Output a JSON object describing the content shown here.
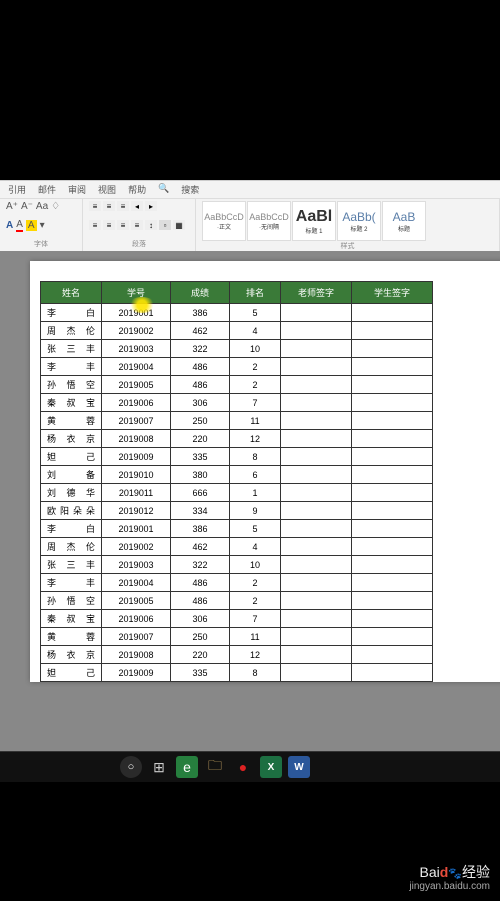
{
  "ribbon": {
    "tabs": [
      "引用",
      "邮件",
      "审阅",
      "视图",
      "帮助",
      "搜索"
    ],
    "font_group": "字体",
    "para_group": "段落",
    "styles_group": "样式",
    "font_buttons": [
      "A⁺",
      "A⁻",
      "Aa",
      "Aa"
    ],
    "font_buttons2": [
      "A",
      "A",
      "A",
      "A"
    ],
    "styles": [
      {
        "preview": "AaBbCcD",
        "label": "·正文"
      },
      {
        "preview": "AaBbCcD",
        "label": "·无间隔"
      },
      {
        "preview": "AaBl",
        "label": "标题 1"
      },
      {
        "preview": "AaBb(",
        "label": "标题 2"
      },
      {
        "preview": "AaB",
        "label": "标题"
      }
    ]
  },
  "chart_data": {
    "type": "table",
    "title": "",
    "columns": [
      "姓名",
      "学号",
      "成绩",
      "排名",
      "老师签字",
      "学生签字"
    ],
    "rows": [
      {
        "name": "李　　白",
        "id": "2019001",
        "score": "386",
        "rank": "5",
        "sig1": "",
        "sig2": ""
      },
      {
        "name": "周　杰　伦",
        "id": "2019002",
        "score": "462",
        "rank": "4",
        "sig1": "",
        "sig2": ""
      },
      {
        "name": "张　三　丰",
        "id": "2019003",
        "score": "322",
        "rank": "10",
        "sig1": "",
        "sig2": ""
      },
      {
        "name": "李　　丰",
        "id": "2019004",
        "score": "486",
        "rank": "2",
        "sig1": "",
        "sig2": ""
      },
      {
        "name": "孙　悟　空",
        "id": "2019005",
        "score": "486",
        "rank": "2",
        "sig1": "",
        "sig2": ""
      },
      {
        "name": "秦　叔　宝",
        "id": "2019006",
        "score": "306",
        "rank": "7",
        "sig1": "",
        "sig2": ""
      },
      {
        "name": "黄　　蓉",
        "id": "2019007",
        "score": "250",
        "rank": "11",
        "sig1": "",
        "sig2": ""
      },
      {
        "name": "杨　衣　京",
        "id": "2019008",
        "score": "220",
        "rank": "12",
        "sig1": "",
        "sig2": ""
      },
      {
        "name": "妲　　己",
        "id": "2019009",
        "score": "335",
        "rank": "8",
        "sig1": "",
        "sig2": ""
      },
      {
        "name": "刘　　备",
        "id": "2019010",
        "score": "380",
        "rank": "6",
        "sig1": "",
        "sig2": ""
      },
      {
        "name": "刘　德　华",
        "id": "2019011",
        "score": "666",
        "rank": "1",
        "sig1": "",
        "sig2": ""
      },
      {
        "name": "欧阳朵朵",
        "id": "2019012",
        "score": "334",
        "rank": "9",
        "sig1": "",
        "sig2": ""
      },
      {
        "name": "李　　白",
        "id": "2019001",
        "score": "386",
        "rank": "5",
        "sig1": "",
        "sig2": ""
      },
      {
        "name": "周　杰　伦",
        "id": "2019002",
        "score": "462",
        "rank": "4",
        "sig1": "",
        "sig2": ""
      },
      {
        "name": "张　三　丰",
        "id": "2019003",
        "score": "322",
        "rank": "10",
        "sig1": "",
        "sig2": ""
      },
      {
        "name": "李　　丰",
        "id": "2019004",
        "score": "486",
        "rank": "2",
        "sig1": "",
        "sig2": ""
      },
      {
        "name": "孙　悟　空",
        "id": "2019005",
        "score": "486",
        "rank": "2",
        "sig1": "",
        "sig2": ""
      },
      {
        "name": "秦　叔　宝",
        "id": "2019006",
        "score": "306",
        "rank": "7",
        "sig1": "",
        "sig2": ""
      },
      {
        "name": "黄　　蓉",
        "id": "2019007",
        "score": "250",
        "rank": "11",
        "sig1": "",
        "sig2": ""
      },
      {
        "name": "杨　衣　京",
        "id": "2019008",
        "score": "220",
        "rank": "12",
        "sig1": "",
        "sig2": ""
      },
      {
        "name": "妲　　己",
        "id": "2019009",
        "score": "335",
        "rank": "8",
        "sig1": "",
        "sig2": ""
      }
    ]
  },
  "watermark": {
    "brand_prefix": "Bai",
    "brand_mid": "d",
    "brand_suffix": "经验",
    "url": "jingyan.baidu.com"
  }
}
